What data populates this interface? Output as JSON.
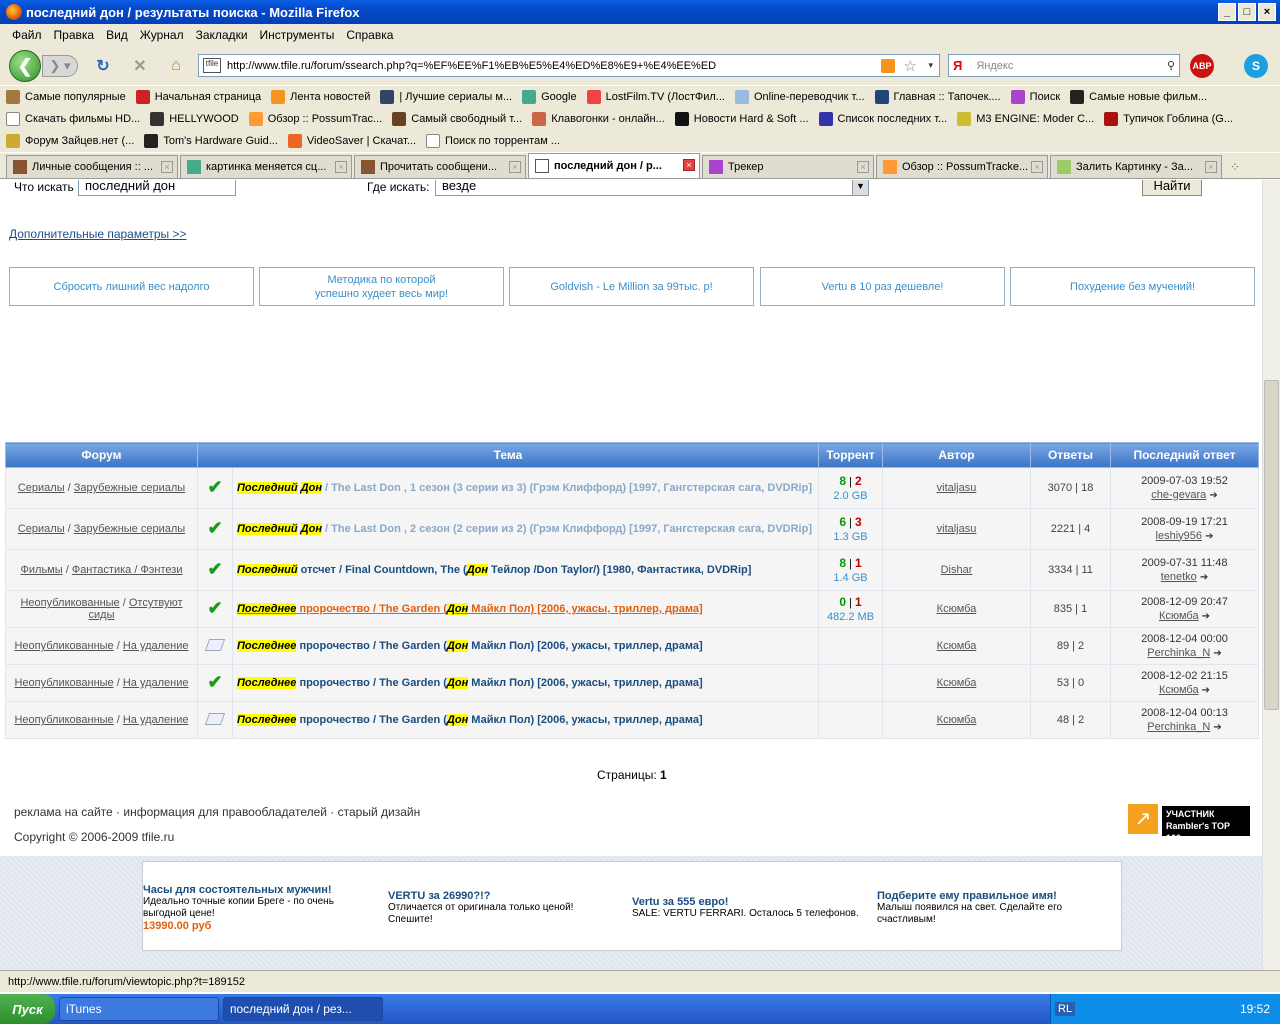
{
  "window": {
    "title": "последний дон / результаты поиска - Mozilla Firefox"
  },
  "menu": [
    "Файл",
    "Правка",
    "Вид",
    "Журнал",
    "Закладки",
    "Инструменты",
    "Справка"
  ],
  "nav": {
    "url": "http://www.tfile.ru/forum/ssearch.php?q=%EF%EE%F1%EB%E5%E4%ED%E8%E9+%E4%EE%ED",
    "site_badge": "tfile",
    "search_engine": "Я",
    "search_placeholder": "Яндекс",
    "abp": "ABP"
  },
  "bookmarks_row1": [
    "Самые популярные",
    "Начальная страница",
    "Лента новостей",
    "| Лучшие сериалы м...",
    "Google",
    "LostFilm.TV (ЛостФил...",
    "Online-переводчик т...",
    "Главная :: Тапочек....",
    "Поиск",
    "Самые новые фильм..."
  ],
  "bookmarks_row2": [
    "Скачать фильмы HD...",
    "HELLYWOOD",
    "Обзор :: PossumTrac...",
    "Самый свободный т...",
    "Клавогонки - онлайн...",
    "Новости Hard & Soft ...",
    "Список последних т...",
    "M3 ENGINE: Moder C...",
    "Тупичок Гоблина (G..."
  ],
  "bookmarks_row3": [
    "Форум Зайцев.нет (...",
    "Tom's Hardware Guid...",
    "VideoSaver | Скачат...",
    "Поиск по торрентам ..."
  ],
  "tabs": [
    "Личные сообщения :: ...",
    "картинка меняется сц...",
    "Прочитать сообщени...",
    "последний дон / р...",
    "Трекер",
    "Обзор :: PossumTracke...",
    "Залить Картинку - За..."
  ],
  "search_form": {
    "what_label": "Что искать",
    "what_value": "последний дон",
    "where_label": "Где искать:",
    "where_value": "везде",
    "submit": "Найти",
    "advanced": "Дополнительные параметры >>"
  },
  "ads_top": [
    "Сбросить лишний вес надолго",
    "Методика по которой успешно худеет весь мир!",
    "Goldvish - Le Million за 99тыс. р!",
    "Vertu в 10 раз дешевле!",
    "Похудение без мучений!"
  ],
  "table": {
    "headers": [
      "Форум",
      "Тема",
      "Торрент",
      "Автор",
      "Ответы",
      "Последний ответ"
    ],
    "rows": [
      {
        "f1": "Сериалы",
        "f2": "Зарубежные сериалы",
        "hl1": "Последний",
        "hl2": "Дон",
        "pre": "",
        "mid": "",
        "rest": " / The Last Don , 1 сезон (3 серии из 3) (Грэм Клиффорд) [1997, Гангстерская сага, DVDRip]",
        "seed": "8",
        "leech": "2",
        "size": "2.0 GB",
        "author": "vitaljasu",
        "ans": "3070 | 18",
        "date": "2009-07-03 19:52",
        "by": "che-gevara",
        "icon": "check"
      },
      {
        "f1": "Сериалы",
        "f2": "Зарубежные сериалы",
        "hl1": "Последний",
        "hl2": "Дон",
        "pre": "",
        "mid": "",
        "rest": " / The Last Don , 2 сезон (2 серии из 2) (Грэм Клиффорд) [1997, Гангстерская сага, DVDRip]",
        "seed": "6",
        "leech": "3",
        "size": "1.3 GB",
        "author": "vitaljasu",
        "ans": "2221 | 4",
        "date": "2008-09-19 17:21",
        "by": "leshiy956",
        "icon": "check"
      },
      {
        "f1": "Фильмы",
        "f2": "Фантастика / Фэнтези",
        "hl1": "Последний",
        "hl2": "Дон",
        "pre": " отсчет / Final Countdown, The (",
        "mid": "",
        "rest": " Тейлор /Don Taylor/) [1980, Фантастика, DVDRip]",
        "seed": "8",
        "leech": "1",
        "size": "1.4 GB",
        "author": "Dishar",
        "ans": "3334 | 11",
        "date": "2009-07-31 11:48",
        "by": "tenetko",
        "icon": "check"
      },
      {
        "f1": "Неопубликованные",
        "f2": "Отсутвуют сиды",
        "hl1": "Последнее",
        "hl2": "Дон",
        "pre": " пророчество / The Garden (",
        "mid": "",
        "rest": " Майкл Пол) [2006, ужасы, триллер, драма]",
        "seed": "0",
        "leech": "1",
        "size": "482.2 MB",
        "author": "Ксюмба",
        "ans": "835 | 1",
        "date": "2008-12-09 20:47",
        "by": "Ксюмба",
        "icon": "check",
        "orange": true
      },
      {
        "f1": "Неопубликованные",
        "f2": "На удаление",
        "hl1": "Последнее",
        "hl2": "Дон",
        "pre": " пророчество / The Garden (",
        "mid": "",
        "rest": " Майкл Пол) [2006, ужасы, триллер, драма]",
        "seed": "",
        "leech": "",
        "size": "",
        "author": "Ксюмба",
        "ans": "89 | 2",
        "date": "2008-12-04 00:00",
        "by": "Perchinka_N",
        "icon": "doc"
      },
      {
        "f1": "Неопубликованные",
        "f2": "На удаление",
        "hl1": "Последнее",
        "hl2": "Дон",
        "pre": " пророчество / The Garden (",
        "mid": "",
        "rest": " Майкл Пол) [2006, ужасы, триллер, драма]",
        "seed": "",
        "leech": "",
        "size": "",
        "author": "Ксюмба",
        "ans": "53 | 0",
        "date": "2008-12-02 21:15",
        "by": "Ксюмба",
        "icon": "check"
      },
      {
        "f1": "Неопубликованные",
        "f2": "На удаление",
        "hl1": "Последнее",
        "hl2": "Дон",
        "pre": " пророчество / The Garden (",
        "mid": "",
        "rest": " Майкл Пол) [2006, ужасы, триллер, драма]",
        "seed": "",
        "leech": "",
        "size": "",
        "author": "Ксюмба",
        "ans": "48 | 2",
        "date": "2008-12-04 00:13",
        "by": "Perchinka_N",
        "icon": "doc"
      }
    ]
  },
  "pages": {
    "label": "Страницы:",
    "current": "1"
  },
  "footer": {
    "links": "реклама на сайте · информация для правообладателей · старый дизайн",
    "copyright": "Copyright © 2006-2009 tfile.ru",
    "rambler": "УЧАСТНИК Rambler's TOP 100"
  },
  "ads_bottom": [
    {
      "title": "Часы для состоятельных мужчин!",
      "text": "Идеально точные копии Брегe - по очень выгодной цене!",
      "price": "13990.00 руб"
    },
    {
      "title": "VERTU за 26990?!?",
      "text": "Отличается от оригинала только ценой! Спешите!",
      "price": ""
    },
    {
      "title": "Vertu за 555 евро!",
      "text": "SALE: VERTU FERRARI. Осталось 5 телефонов.",
      "price": ""
    },
    {
      "title": "Подберите ему правильное имя!",
      "text": "Малыш появился на свет. Сделайте его счастливым!",
      "price": ""
    }
  ],
  "status": "http://www.tfile.ru/forum/viewtopic.php?t=189152",
  "taskbar": {
    "start": "Пуск",
    "tasks": [
      "iTunes",
      "последний дон / рез..."
    ],
    "lang": "RL",
    "clock": "19:52"
  }
}
